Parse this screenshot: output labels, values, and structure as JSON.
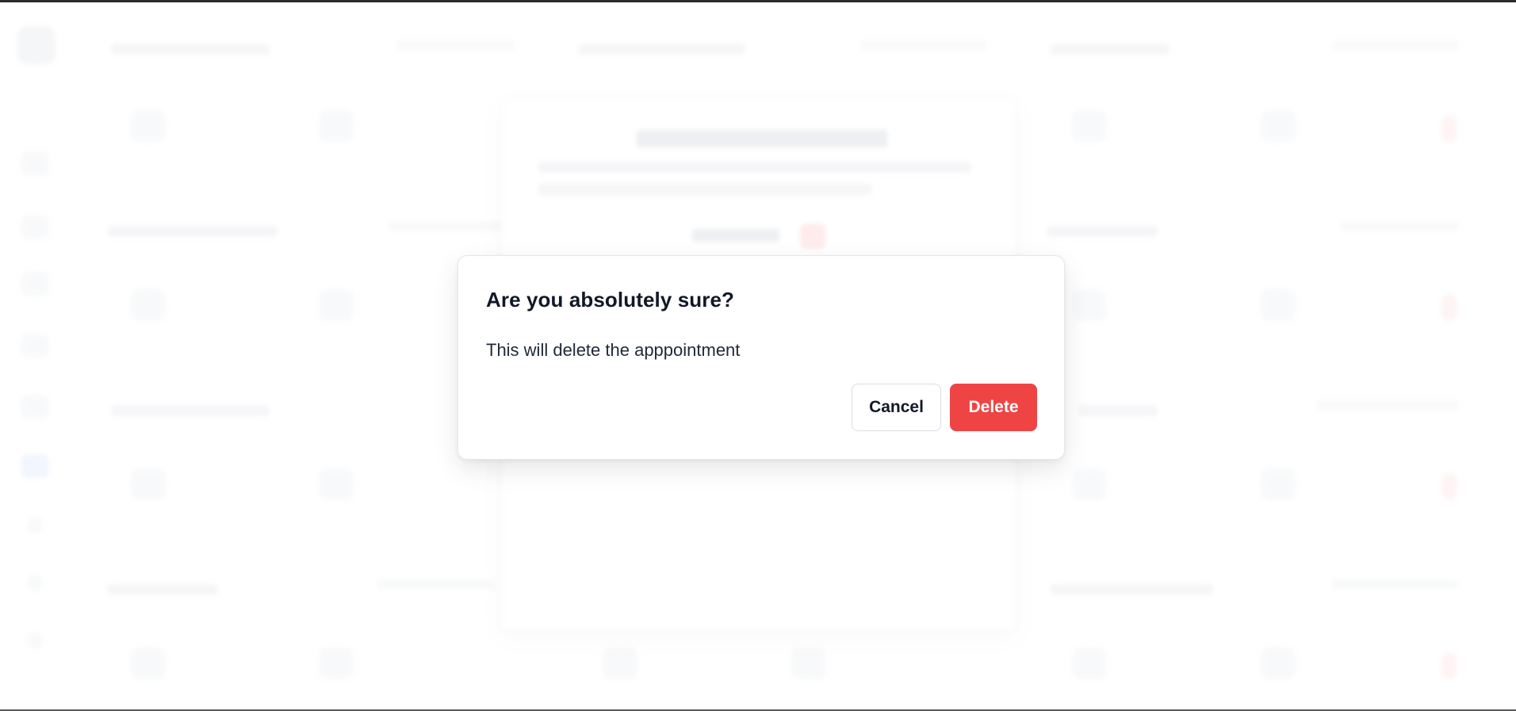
{
  "dialog": {
    "title": "Are you absolutely sure?",
    "description": "This will delete the apppointment",
    "cancel_label": "Cancel",
    "delete_label": "Delete"
  },
  "colors": {
    "delete_button": "#ef4444",
    "overlay": "rgba(255,255,255,0.35)",
    "text_primary": "#111827"
  }
}
